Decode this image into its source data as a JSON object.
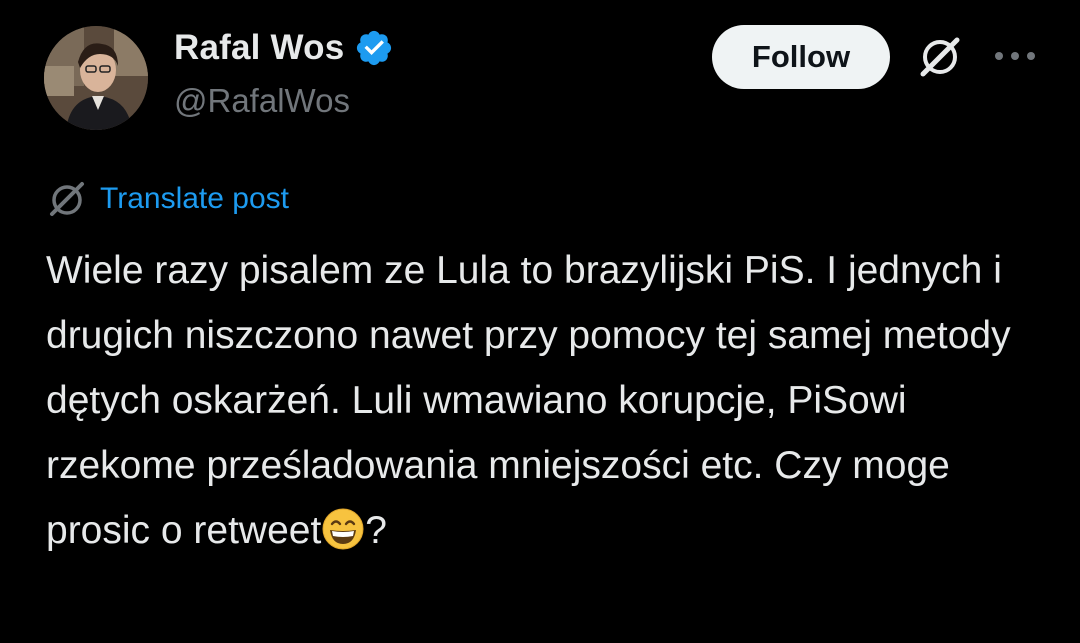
{
  "author": {
    "display_name": "Rafal Wos",
    "handle": "@RafalWos",
    "verified": true,
    "avatar_icon": "profile-photo"
  },
  "header": {
    "follow_label": "Follow",
    "grok_icon": "grok-icon",
    "more_icon": "more-dots-icon"
  },
  "translate": {
    "label": "Translate post",
    "icon": "grok-translate-icon"
  },
  "post": {
    "text": "Wiele razy pisalem ze Lula to brazylijski PiS. I jednych i drugich niszczono nawet przy pomocy tej samej metody dętych oskarżeń. Luli wmawiano korupcje, PiSowi rzekome prześladowania mniejszości etc. Czy moge prosic o retweet",
    "trailing_text": "?",
    "emoji": "grinning-face-with-smiling-eyes"
  },
  "colors": {
    "background": "#000000",
    "text": "#e7e9ea",
    "secondary": "#71767b",
    "link": "#1d9bf0",
    "verified": "#1d9bf0",
    "follow_bg": "#eff3f4"
  }
}
